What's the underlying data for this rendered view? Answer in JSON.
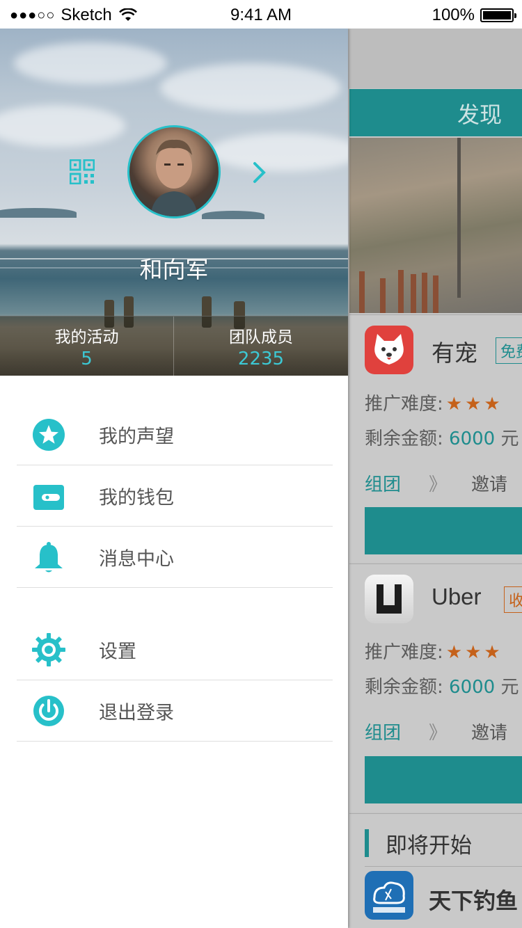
{
  "status_bar": {
    "signal": "●●●○○",
    "carrier": "Sketch",
    "time": "9:41 AM",
    "battery": "100%"
  },
  "profile": {
    "name": "和向军",
    "avatar_icon": "avatar-photo",
    "qr_icon": "qr-code-icon",
    "chevron_icon": "chevron-right-icon"
  },
  "stats": [
    {
      "label": "我的活动",
      "value": "5"
    },
    {
      "label": "团队成员",
      "value": "2235"
    }
  ],
  "menu": [
    {
      "label": "我的声望",
      "icon": "star-icon"
    },
    {
      "label": "我的钱包",
      "icon": "wallet-icon"
    },
    {
      "label": "消息中心",
      "icon": "bell-icon"
    },
    {
      "label": "设置",
      "icon": "gear-icon"
    },
    {
      "label": "退出登录",
      "icon": "power-icon"
    }
  ],
  "background_page": {
    "tab_title": "发现",
    "cards": [
      {
        "name": "有宠",
        "badge": "免费",
        "difficulty_label": "推广难度:",
        "remaining_label": "剩余金额:",
        "amount": "6000",
        "unit": "元",
        "team": "组团",
        "separator": "》",
        "invite": "邀请",
        "stars": 3
      },
      {
        "name": "Uber",
        "badge": "收费",
        "difficulty_label": "推广难度:",
        "remaining_label": "剩余金额:",
        "amount": "6000",
        "unit": "元",
        "team": "组团",
        "separator": "》",
        "invite": "邀请",
        "stars": 3
      }
    ],
    "upcoming": {
      "title": "即将开始",
      "app_name": "天下钓鱼"
    }
  },
  "colors": {
    "accent": "#27c0c9",
    "teal_dark": "#1e8c8d",
    "star": "#c5611a"
  }
}
